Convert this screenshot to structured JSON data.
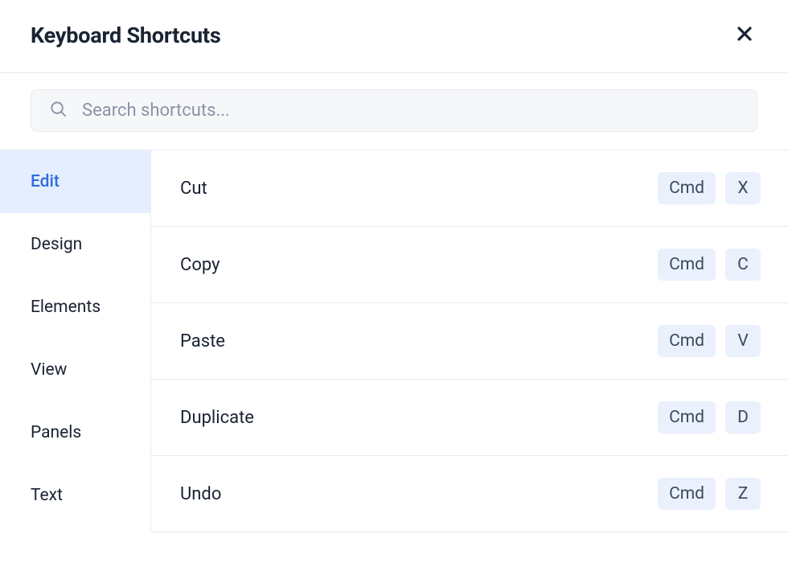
{
  "header": {
    "title": "Keyboard Shortcuts"
  },
  "search": {
    "placeholder": "Search shortcuts..."
  },
  "sidebar": {
    "items": [
      {
        "label": "Edit",
        "active": true
      },
      {
        "label": "Design",
        "active": false
      },
      {
        "label": "Elements",
        "active": false
      },
      {
        "label": "View",
        "active": false
      },
      {
        "label": "Panels",
        "active": false
      },
      {
        "label": "Text",
        "active": false
      }
    ]
  },
  "shortcuts": [
    {
      "label": "Cut",
      "keys": [
        "Cmd",
        "X"
      ]
    },
    {
      "label": "Copy",
      "keys": [
        "Cmd",
        "C"
      ]
    },
    {
      "label": "Paste",
      "keys": [
        "Cmd",
        "V"
      ]
    },
    {
      "label": "Duplicate",
      "keys": [
        "Cmd",
        "D"
      ]
    },
    {
      "label": "Undo",
      "keys": [
        "Cmd",
        "Z"
      ]
    }
  ]
}
